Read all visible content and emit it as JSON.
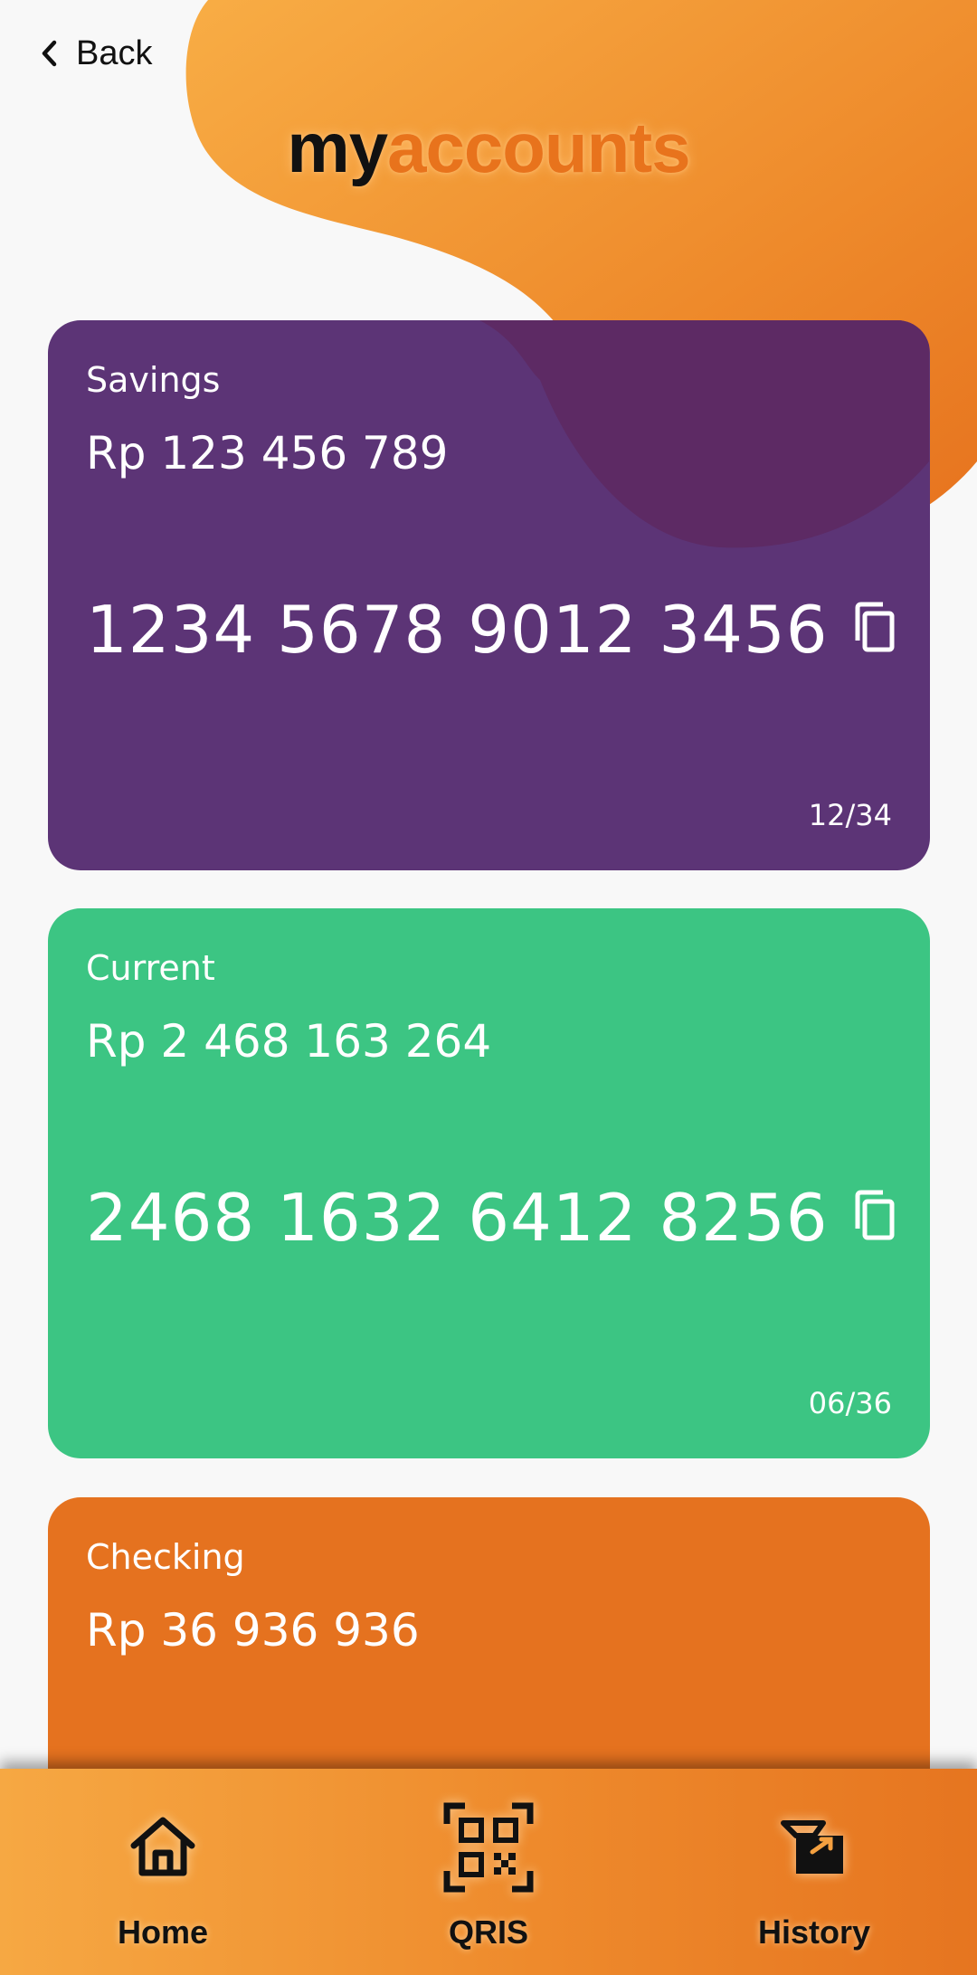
{
  "header": {
    "back_label": "Back",
    "title_prefix": "my",
    "title_suffix": "accounts"
  },
  "accounts": [
    {
      "type": "Savings",
      "balance": "Rp 123 456 789",
      "number": "1234 5678 9012 3456",
      "expiry": "12/34",
      "color": "#5c3476"
    },
    {
      "type": "Current",
      "balance": "Rp 2 468 163 264",
      "number": "2468 1632 6412 8256",
      "expiry": "06/36",
      "color": "#3cc583"
    },
    {
      "type": "Checking",
      "balance": "Rp 36 936 936",
      "color": "#e5721f"
    }
  ],
  "nav": {
    "items": [
      {
        "label": "Home",
        "icon": "home-icon"
      },
      {
        "label": "QRIS",
        "icon": "qr-code-icon"
      },
      {
        "label": "History",
        "icon": "history-icon"
      }
    ]
  },
  "colors": {
    "accent": "#e8731c",
    "background": "#f8f8f8",
    "nav_gradient_start": "#f6a843",
    "nav_gradient_end": "#e67520"
  }
}
